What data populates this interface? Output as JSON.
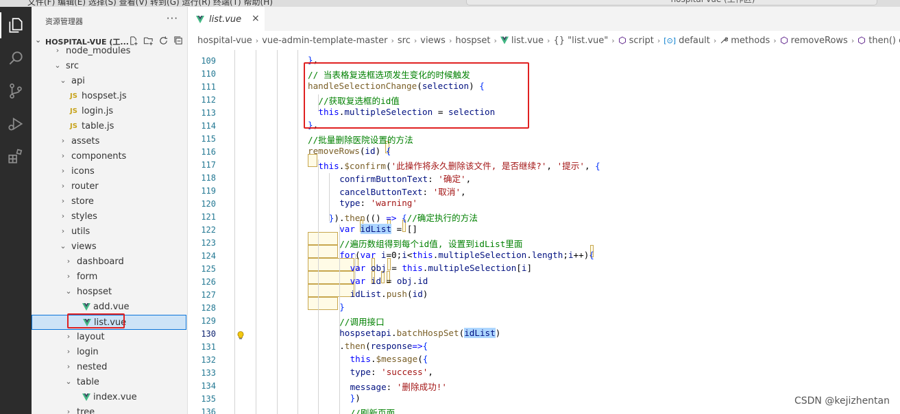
{
  "titlebar": {
    "menu_text": "文件(F)   编辑(E)   选择(S)   查看(V)   转到(G)   运行(R)   终端(T)   帮助(H)",
    "search_text": "hospital-vue (工作区)"
  },
  "activity_bar": {
    "items": [
      {
        "name": "explorer-icon"
      },
      {
        "name": "search-icon"
      },
      {
        "name": "source-control-icon"
      },
      {
        "name": "run-debug-icon"
      },
      {
        "name": "extensions-icon"
      }
    ]
  },
  "sidebar": {
    "title": "资源管理器",
    "more": "···",
    "workspace_label": "HOSPITAL-VUE (工...",
    "tree": [
      {
        "name": "node_modules",
        "kind": "folder",
        "open": false,
        "depth": 1
      },
      {
        "name": "src",
        "kind": "folder",
        "open": true,
        "depth": 1
      },
      {
        "name": "api",
        "kind": "folder",
        "open": true,
        "depth": 2
      },
      {
        "name": "hospset.js",
        "kind": "js",
        "depth": 3
      },
      {
        "name": "login.js",
        "kind": "js",
        "depth": 3
      },
      {
        "name": "table.js",
        "kind": "js",
        "depth": 3
      },
      {
        "name": "assets",
        "kind": "folder",
        "open": false,
        "depth": 2
      },
      {
        "name": "components",
        "kind": "folder",
        "open": false,
        "depth": 2
      },
      {
        "name": "icons",
        "kind": "folder",
        "open": false,
        "depth": 2
      },
      {
        "name": "router",
        "kind": "folder",
        "open": false,
        "depth": 2
      },
      {
        "name": "store",
        "kind": "folder",
        "open": false,
        "depth": 2
      },
      {
        "name": "styles",
        "kind": "folder",
        "open": false,
        "depth": 2
      },
      {
        "name": "utils",
        "kind": "folder",
        "open": false,
        "depth": 2
      },
      {
        "name": "views",
        "kind": "folder",
        "open": true,
        "depth": 2
      },
      {
        "name": "dashboard",
        "kind": "folder",
        "open": false,
        "depth": 3
      },
      {
        "name": "form",
        "kind": "folder",
        "open": false,
        "depth": 3
      },
      {
        "name": "hospset",
        "kind": "folder",
        "open": true,
        "depth": 3
      },
      {
        "name": "add.vue",
        "kind": "vue",
        "depth": 4
      },
      {
        "name": "list.vue",
        "kind": "vue",
        "depth": 4,
        "selected": true
      },
      {
        "name": "layout",
        "kind": "folder",
        "open": false,
        "depth": 3
      },
      {
        "name": "login",
        "kind": "folder",
        "open": false,
        "depth": 3
      },
      {
        "name": "nested",
        "kind": "folder",
        "open": false,
        "depth": 3
      },
      {
        "name": "table",
        "kind": "folder",
        "open": true,
        "depth": 3
      },
      {
        "name": "index.vue",
        "kind": "vue",
        "depth": 4
      },
      {
        "name": "tree",
        "kind": "folder",
        "open": false,
        "depth": 3
      }
    ]
  },
  "editor": {
    "tab": {
      "label": "list.vue",
      "close": "×"
    },
    "breadcrumb": [
      "hospital-vue",
      "vue-admin-template-master",
      "src",
      "views",
      "hospset",
      "list.vue",
      "{} \"list.vue\"",
      "script",
      "default",
      "methods",
      "removeRows",
      "then() callback"
    ],
    "current_line": 130,
    "lines": [
      {
        "n": 109,
        "indent": 0,
        "html": "<span class='p'>}</span>,"
      },
      {
        "n": 110,
        "indent": 0,
        "html": "<span class='c'>// 当表格复选框选项发生变化的时候触发</span>"
      },
      {
        "n": 111,
        "indent": 0,
        "html": "<span class='f'>handleSelectionChange</span>(<span class='v'>selection</span>) <span class='p'>{</span>"
      },
      {
        "n": 112,
        "indent": 1,
        "html": "<span class='c'>//获取复选框的id值</span>"
      },
      {
        "n": 113,
        "indent": 1,
        "html": "<span class='k'>this</span>.<span class='v'>multipleSelection</span> = <span class='v'>selection</span>"
      },
      {
        "n": 114,
        "indent": 0,
        "html": "<span class='p'>}</span>,"
      },
      {
        "n": 115,
        "indent": 0,
        "html": "<span class='c'>//批量删除医院设置的方法</span>"
      },
      {
        "n": 116,
        "indent": 0,
        "html": "<span class='f'>removeRows</span>(<span class='v'>id</span>) <span class='p'>{</span>"
      },
      {
        "n": 117,
        "indent": 1,
        "html": "<span class='k'>this</span>.<span class='f'>$confirm</span>(<span class='s'>'此操作将永久删除该文件, 是否继续?'</span>, <span class='s'>'提示'</span>, <span class='p'>{</span>"
      },
      {
        "n": 118,
        "indent": 3,
        "html": "<span class='v'>confirmButtonText</span>: <span class='s'>'确定'</span>,"
      },
      {
        "n": 119,
        "indent": 3,
        "html": "<span class='v'>cancelButtonText</span>: <span class='s'>'取消'</span>,"
      },
      {
        "n": 120,
        "indent": 3,
        "html": "<span class='v'>type</span>: <span class='s'>'warning'</span>"
      },
      {
        "n": 121,
        "indent": 2,
        "html": "<span class='p'>}</span>).<span class='f'>then</span>(() <span class='k'>=&gt;</span> <span class='p'>{</span><span class='c'>//确定执行的方法</span>"
      },
      {
        "n": 122,
        "indent": 3,
        "html": "<span class='k'>var</span> <span class='v sel'>idList</span> = []"
      },
      {
        "n": 123,
        "indent": 3,
        "html": "<span class='c'>//遍历数组得到每个id值, 设置到idList里面</span>"
      },
      {
        "n": 124,
        "indent": 3,
        "html": "<span class='k'>for</span>(<span class='k'>var</span> <span class='v'>i</span>=0;<span class='v'>i</span>&lt;<span class='k'>this</span>.<span class='v'>multipleSelection</span>.<span class='v'>length</span>;<span class='v'>i</span>++)<span class='p'>{</span>"
      },
      {
        "n": 125,
        "indent": 4,
        "html": "<span class='k'>var</span> <span class='v'>obj</span> = <span class='k'>this</span>.<span class='v'>multipleSelection</span>[<span class='v'>i</span>]"
      },
      {
        "n": 126,
        "indent": 4,
        "html": "<span class='k'>var</span> <span class='v'>id</span> = <span class='v'>obj</span>.<span class='v'>id</span>"
      },
      {
        "n": 127,
        "indent": 4,
        "html": "<span class='v'>idList</span>.<span class='f'>push</span>(<span class='v'>id</span>)"
      },
      {
        "n": 128,
        "indent": 3,
        "html": "<span class='p'>}</span>"
      },
      {
        "n": 129,
        "indent": 3,
        "html": "<span class='c'>//调用接口</span>"
      },
      {
        "n": 130,
        "indent": 3,
        "html": "<span class='v'>hospsetapi</span>.<span class='f'>batchHospSet</span>(<span class='v sel'>idList</span>)"
      },
      {
        "n": 131,
        "indent": 3,
        "html": ".<span class='f'>then</span>(<span class='v'>response</span><span class='k'>=&gt;</span><span class='p'>{</span>"
      },
      {
        "n": 132,
        "indent": 4,
        "html": "<span class='k'>this</span>.<span class='f'>$message</span>(<span class='p'>{</span>"
      },
      {
        "n": 133,
        "indent": 4,
        "html": "<span class='v'>type</span>: <span class='s'>'success'</span>,"
      },
      {
        "n": 134,
        "indent": 4,
        "html": "<span class='v'>message</span>: <span class='s'>'删除成功!'</span>"
      },
      {
        "n": 135,
        "indent": 4,
        "html": "<span class='p'>}</span>)"
      },
      {
        "n": 136,
        "indent": 4,
        "html": "<span class='c'>//刷新页面</span>"
      }
    ]
  },
  "watermark": "CSDN @kejizhentan",
  "colors": {
    "activity_bar": "#2c2c2c",
    "sidebar": "#f3f3f3",
    "selection": "#cde3f7",
    "annotation_red": "#e02020",
    "vue_green": "#41b883",
    "js_yellow": "#c7a31b"
  }
}
